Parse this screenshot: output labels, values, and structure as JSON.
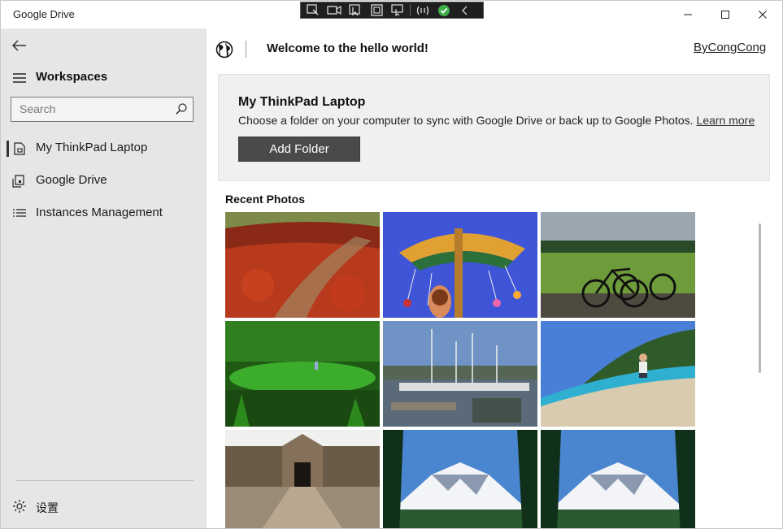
{
  "window": {
    "title": "Google Drive"
  },
  "sidebar": {
    "workspaces_label": "Workspaces",
    "search": {
      "placeholder": "Search",
      "value": ""
    },
    "items": [
      {
        "label": "My ThinkPad Laptop",
        "icon": "laptop-icon",
        "selected": true
      },
      {
        "label": "Google Drive",
        "icon": "drive-icon",
        "selected": false
      },
      {
        "label": "Instances Management",
        "icon": "list-icon",
        "selected": false
      }
    ],
    "settings_label": "设置"
  },
  "header": {
    "welcome": "Welcome to the hello world!",
    "author_link": "ByCongCong"
  },
  "sync_card": {
    "title": "My ThinkPad Laptop",
    "description": "Choose a folder on your computer to sync with Google Drive or back up to Google Photos.",
    "learn_more": "Learn more",
    "button_label": "Add Folder"
  },
  "recent": {
    "title": "Recent Photos",
    "photos": [
      {
        "subject": "red-leaves-path"
      },
      {
        "subject": "swing-carousel"
      },
      {
        "subject": "bicycles-field"
      },
      {
        "subject": "green-forest-pond"
      },
      {
        "subject": "marina-boats"
      },
      {
        "subject": "child-beach"
      },
      {
        "subject": "stone-fortress"
      },
      {
        "subject": "snowy-mountain"
      },
      {
        "subject": "snowy-mountain"
      }
    ]
  },
  "colors": {
    "sidebar_bg": "#e6e6e6",
    "button_bg": "#4a4a4a",
    "card_bg": "#f0f0f0"
  }
}
